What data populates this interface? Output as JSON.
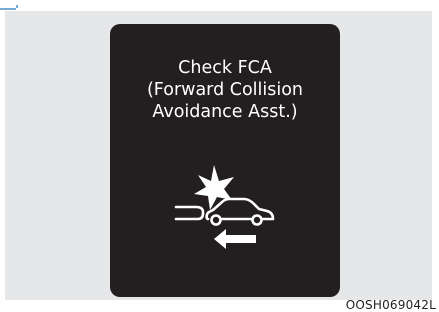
{
  "display": {
    "line1": "Check FCA",
    "line2": "(Forward Collision",
    "line3": "Avoidance Asst.)"
  },
  "icon": {
    "name": "forward-collision-warning-icon",
    "parts": [
      "star-burst-icon",
      "car-rear-icon",
      "car-front-icon",
      "arrow-left-icon"
    ]
  },
  "caption": "OOSH069042L",
  "colors": {
    "panel_background": "#e6e7e8",
    "display_background": "#231f20",
    "display_text": "#ffffff",
    "top_accent": "#4a90c8"
  }
}
